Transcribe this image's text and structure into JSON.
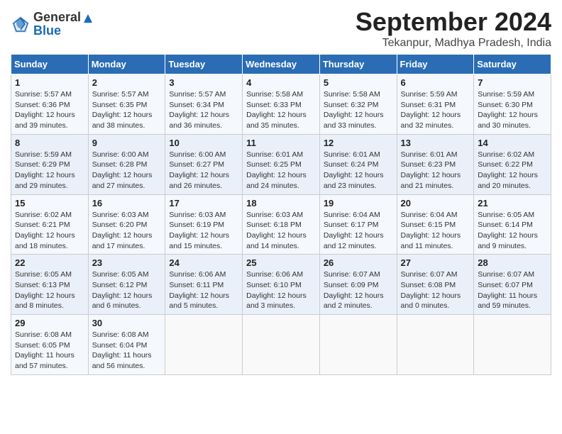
{
  "header": {
    "logo_line1": "General",
    "logo_line2": "Blue",
    "month_title": "September 2024",
    "location": "Tekanpur, Madhya Pradesh, India"
  },
  "weekdays": [
    "Sunday",
    "Monday",
    "Tuesday",
    "Wednesday",
    "Thursday",
    "Friday",
    "Saturday"
  ],
  "weeks": [
    [
      {
        "day": "1",
        "detail": "Sunrise: 5:57 AM\nSunset: 6:36 PM\nDaylight: 12 hours\nand 39 minutes."
      },
      {
        "day": "2",
        "detail": "Sunrise: 5:57 AM\nSunset: 6:35 PM\nDaylight: 12 hours\nand 38 minutes."
      },
      {
        "day": "3",
        "detail": "Sunrise: 5:57 AM\nSunset: 6:34 PM\nDaylight: 12 hours\nand 36 minutes."
      },
      {
        "day": "4",
        "detail": "Sunrise: 5:58 AM\nSunset: 6:33 PM\nDaylight: 12 hours\nand 35 minutes."
      },
      {
        "day": "5",
        "detail": "Sunrise: 5:58 AM\nSunset: 6:32 PM\nDaylight: 12 hours\nand 33 minutes."
      },
      {
        "day": "6",
        "detail": "Sunrise: 5:59 AM\nSunset: 6:31 PM\nDaylight: 12 hours\nand 32 minutes."
      },
      {
        "day": "7",
        "detail": "Sunrise: 5:59 AM\nSunset: 6:30 PM\nDaylight: 12 hours\nand 30 minutes."
      }
    ],
    [
      {
        "day": "8",
        "detail": "Sunrise: 5:59 AM\nSunset: 6:29 PM\nDaylight: 12 hours\nand 29 minutes."
      },
      {
        "day": "9",
        "detail": "Sunrise: 6:00 AM\nSunset: 6:28 PM\nDaylight: 12 hours\nand 27 minutes."
      },
      {
        "day": "10",
        "detail": "Sunrise: 6:00 AM\nSunset: 6:27 PM\nDaylight: 12 hours\nand 26 minutes."
      },
      {
        "day": "11",
        "detail": "Sunrise: 6:01 AM\nSunset: 6:25 PM\nDaylight: 12 hours\nand 24 minutes."
      },
      {
        "day": "12",
        "detail": "Sunrise: 6:01 AM\nSunset: 6:24 PM\nDaylight: 12 hours\nand 23 minutes."
      },
      {
        "day": "13",
        "detail": "Sunrise: 6:01 AM\nSunset: 6:23 PM\nDaylight: 12 hours\nand 21 minutes."
      },
      {
        "day": "14",
        "detail": "Sunrise: 6:02 AM\nSunset: 6:22 PM\nDaylight: 12 hours\nand 20 minutes."
      }
    ],
    [
      {
        "day": "15",
        "detail": "Sunrise: 6:02 AM\nSunset: 6:21 PM\nDaylight: 12 hours\nand 18 minutes."
      },
      {
        "day": "16",
        "detail": "Sunrise: 6:03 AM\nSunset: 6:20 PM\nDaylight: 12 hours\nand 17 minutes."
      },
      {
        "day": "17",
        "detail": "Sunrise: 6:03 AM\nSunset: 6:19 PM\nDaylight: 12 hours\nand 15 minutes."
      },
      {
        "day": "18",
        "detail": "Sunrise: 6:03 AM\nSunset: 6:18 PM\nDaylight: 12 hours\nand 14 minutes."
      },
      {
        "day": "19",
        "detail": "Sunrise: 6:04 AM\nSunset: 6:17 PM\nDaylight: 12 hours\nand 12 minutes."
      },
      {
        "day": "20",
        "detail": "Sunrise: 6:04 AM\nSunset: 6:15 PM\nDaylight: 12 hours\nand 11 minutes."
      },
      {
        "day": "21",
        "detail": "Sunrise: 6:05 AM\nSunset: 6:14 PM\nDaylight: 12 hours\nand 9 minutes."
      }
    ],
    [
      {
        "day": "22",
        "detail": "Sunrise: 6:05 AM\nSunset: 6:13 PM\nDaylight: 12 hours\nand 8 minutes."
      },
      {
        "day": "23",
        "detail": "Sunrise: 6:05 AM\nSunset: 6:12 PM\nDaylight: 12 hours\nand 6 minutes."
      },
      {
        "day": "24",
        "detail": "Sunrise: 6:06 AM\nSunset: 6:11 PM\nDaylight: 12 hours\nand 5 minutes."
      },
      {
        "day": "25",
        "detail": "Sunrise: 6:06 AM\nSunset: 6:10 PM\nDaylight: 12 hours\nand 3 minutes."
      },
      {
        "day": "26",
        "detail": "Sunrise: 6:07 AM\nSunset: 6:09 PM\nDaylight: 12 hours\nand 2 minutes."
      },
      {
        "day": "27",
        "detail": "Sunrise: 6:07 AM\nSunset: 6:08 PM\nDaylight: 12 hours\nand 0 minutes."
      },
      {
        "day": "28",
        "detail": "Sunrise: 6:07 AM\nSunset: 6:07 PM\nDaylight: 11 hours\nand 59 minutes."
      }
    ],
    [
      {
        "day": "29",
        "detail": "Sunrise: 6:08 AM\nSunset: 6:05 PM\nDaylight: 11 hours\nand 57 minutes."
      },
      {
        "day": "30",
        "detail": "Sunrise: 6:08 AM\nSunset: 6:04 PM\nDaylight: 11 hours\nand 56 minutes."
      },
      null,
      null,
      null,
      null,
      null
    ]
  ]
}
